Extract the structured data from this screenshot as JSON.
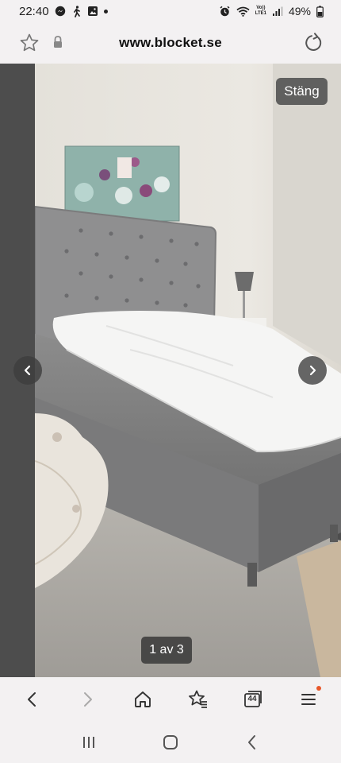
{
  "status_bar": {
    "time": "22:40",
    "battery_percent": "49%",
    "network_label": "LTE1",
    "volte_label": "Vo))"
  },
  "url_bar": {
    "domain": "www.blocket.se"
  },
  "viewer": {
    "close_label": "Stäng",
    "counter_label": "1 av 3",
    "photo_subject": "grey upholstered bed with tufted headboard"
  },
  "toolbar": {
    "tabs_count": "44",
    "icons": [
      "back-icon",
      "forward-icon",
      "home-icon",
      "bookmarks-icon",
      "tabs-icon",
      "menu-icon"
    ],
    "accent": "#e8572a"
  },
  "system_nav": {
    "icons": [
      "recents-icon",
      "home-icon",
      "back-icon"
    ]
  }
}
